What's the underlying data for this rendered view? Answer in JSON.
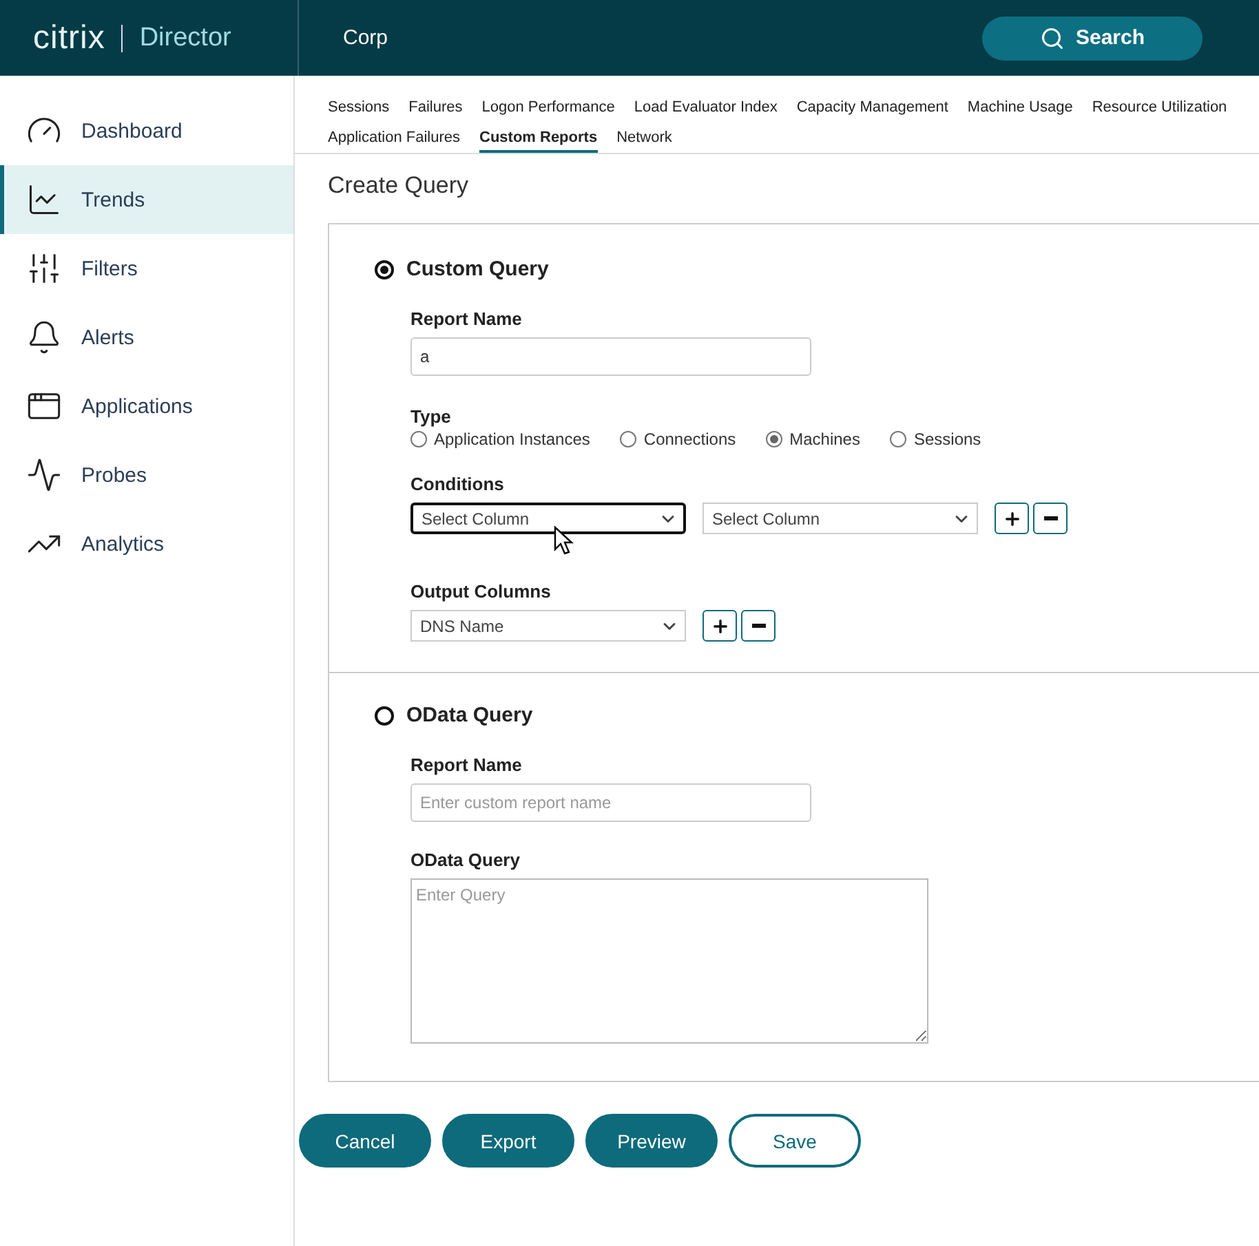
{
  "header": {
    "logo": "citrix",
    "product": "Director",
    "site": "Corp",
    "search_button": "Search"
  },
  "sidebar": {
    "items": [
      {
        "label": "Dashboard",
        "selected": false
      },
      {
        "label": "Trends",
        "selected": true
      },
      {
        "label": "Filters",
        "selected": false
      },
      {
        "label": "Alerts",
        "selected": false
      },
      {
        "label": "Applications",
        "selected": false
      },
      {
        "label": "Probes",
        "selected": false
      },
      {
        "label": "Analytics",
        "selected": false
      }
    ]
  },
  "tab_rows": [
    [
      {
        "label": "Sessions",
        "selected": false
      },
      {
        "label": "Failures",
        "selected": false
      },
      {
        "label": "Logon Performance",
        "selected": false
      },
      {
        "label": "Load Evaluator Index",
        "selected": false
      },
      {
        "label": "Capacity Management",
        "selected": false
      },
      {
        "label": "Machine Usage",
        "selected": false
      },
      {
        "label": "Resource Utilization",
        "selected": false
      }
    ],
    [
      {
        "label": "Application Failures",
        "selected": false
      },
      {
        "label": "Custom Reports",
        "selected": true
      },
      {
        "label": "Network",
        "selected": false
      }
    ]
  ],
  "page_title": "Create Query",
  "custom_query": {
    "title": "Custom Query",
    "selected": true,
    "report_name": {
      "label": "Report Name",
      "value": "a"
    },
    "type": {
      "label": "Type",
      "options": [
        {
          "label": "Application Instances",
          "selected": false
        },
        {
          "label": "Connections",
          "selected": false
        },
        {
          "label": "Machines",
          "selected": true
        },
        {
          "label": "Sessions",
          "selected": false
        }
      ]
    },
    "conditions": {
      "label": "Conditions",
      "selects": [
        {
          "value": "Select Column",
          "focused": true
        },
        {
          "value": "Select Column",
          "focused": false
        }
      ]
    },
    "output_columns": {
      "label": "Output Columns",
      "selects": [
        {
          "value": "DNS Name",
          "focused": false
        }
      ]
    }
  },
  "odata_query": {
    "title": "OData Query",
    "selected": false,
    "report_name": {
      "label": "Report Name",
      "placeholder": "Enter custom report name"
    },
    "query": {
      "label": "OData Query",
      "placeholder": "Enter Query"
    }
  },
  "buttons": [
    {
      "label": "Cancel",
      "kind": "primary"
    },
    {
      "label": "Export",
      "kind": "primary"
    },
    {
      "label": "Preview",
      "kind": "primary"
    },
    {
      "label": "Save",
      "kind": "outline"
    }
  ]
}
